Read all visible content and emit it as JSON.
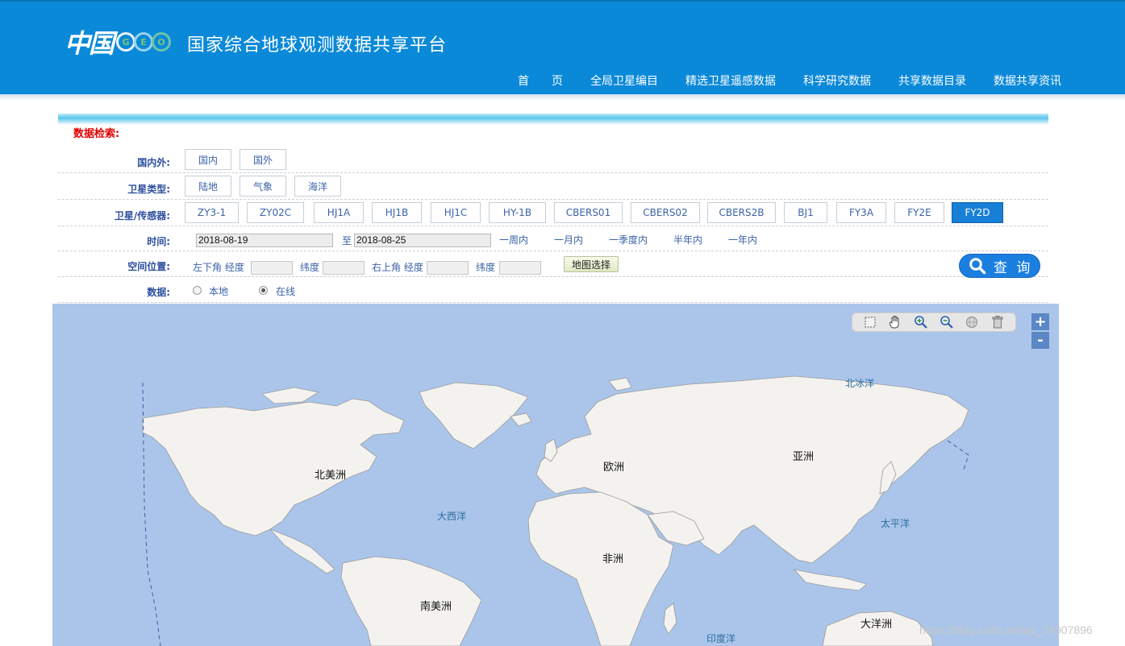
{
  "header": {
    "logo_mark": "中国",
    "logo_geo": [
      "G",
      "E",
      "O"
    ],
    "site_title": "国家综合地球观测数据共享平台",
    "nav": [
      "首　　页",
      "全局卫星编目",
      "精选卫星遥感数据",
      "科学研究数据",
      "共享数据目录",
      "数据共享资讯"
    ]
  },
  "search": {
    "title": "数据检索:",
    "region": {
      "label": "国内外:",
      "options": [
        "国内",
        "国外"
      ]
    },
    "satellite_type": {
      "label": "卫星类型:",
      "options": [
        "陆地",
        "气象",
        "海洋"
      ]
    },
    "sensor": {
      "label": "卫星/传感器:",
      "options": [
        "ZY3-1",
        "ZY02C",
        "HJ1A",
        "HJ1B",
        "HJ1C",
        "HY-1B",
        "CBERS01",
        "CBERS02",
        "CBERS2B",
        "BJ1",
        "FY3A",
        "FY2E",
        "FY2D"
      ],
      "selected": "FY2D"
    },
    "time": {
      "label": "时间:",
      "start": "2018-08-19",
      "to": "至",
      "end": "2018-08-25",
      "quick": [
        "一周内",
        "一月内",
        "一季度内",
        "半年内",
        "一年内"
      ]
    },
    "space": {
      "label": "空间位置:",
      "lower_left": "左下角 经度",
      "lat1": "纬度",
      "upper_right": "右上角 经度",
      "lat2": "纬度",
      "map_select": "地图选择"
    },
    "data": {
      "label": "数据:",
      "options": [
        "本地",
        "在线"
      ],
      "selected": "在线"
    },
    "query_button": "查 询"
  },
  "map": {
    "continents": [
      "北美洲",
      "欧洲",
      "亚洲",
      "非洲",
      "南美洲",
      "大洋洲"
    ],
    "oceans": [
      "北冰洋",
      "大西洋",
      "太平洋",
      "印度洋"
    ],
    "tools": [
      "box-select-icon",
      "pan-hand-icon",
      "zoom-in-icon",
      "zoom-out-icon",
      "globe-icon",
      "trash-icon"
    ],
    "zoom_in": "+",
    "zoom_out": "-",
    "colors": {
      "ocean": "#abc5ea",
      "land": "#f3f2ee",
      "border": "#9a9a9a"
    }
  },
  "watermark": "https://blog.csdn.net/qq_34907896"
}
